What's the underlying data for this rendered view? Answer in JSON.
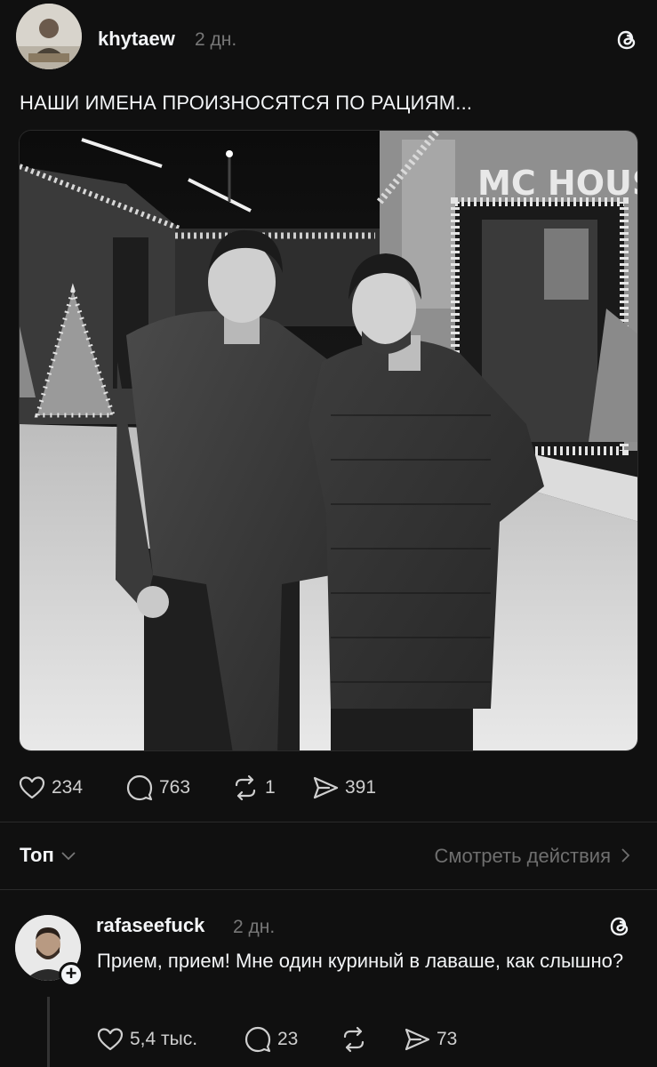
{
  "post": {
    "username": "khytaew",
    "time": "2 дн.",
    "text": "НАШИ ИМЕНА ПРОИЗНОСЯТСЯ ПО РАЦИЯМ...",
    "photo_sign": "MC HOUSE",
    "likes": "234",
    "comments": "763",
    "reposts": "1",
    "shares": "391"
  },
  "sort": {
    "label": "Топ",
    "activity_link": "Смотреть действия"
  },
  "reply": {
    "username": "rafaseefuck",
    "time": "2 дн.",
    "text": "Прием, прием! Мне один куриный в лаваше, как слышно?",
    "likes": "5,4 тыс.",
    "comments": "23",
    "shares": "73"
  },
  "icons": {
    "like": "heart-icon",
    "comment": "comment-bubble-icon",
    "repost": "repost-icon",
    "share": "send-icon",
    "threads": "threads-logo-icon",
    "follow": "plus-icon",
    "chevron": "chevron-icon"
  },
  "colors": {
    "background": "#101010",
    "text": "#f3f5f7",
    "muted": "#777777"
  }
}
